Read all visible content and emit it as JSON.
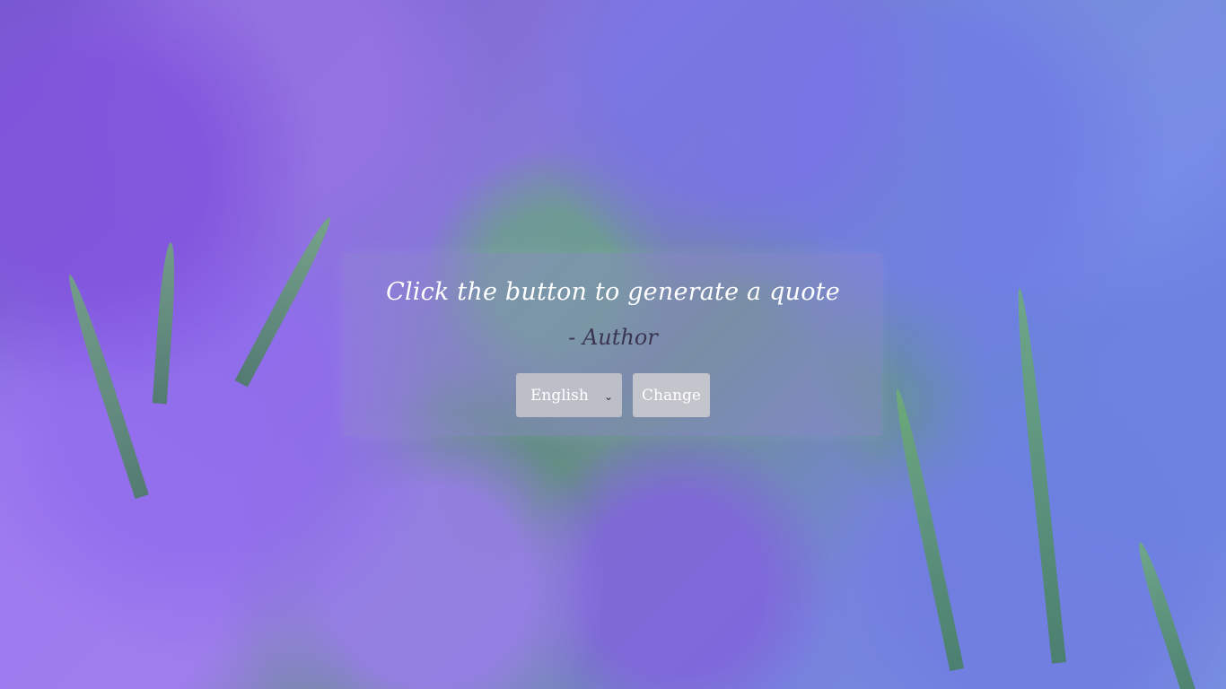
{
  "quote": {
    "text": "Click the button to generate a quote",
    "author": "- Author"
  },
  "controls": {
    "language": {
      "selected": "English",
      "icon": "chevron-down-icon"
    },
    "change_label": "Change"
  },
  "colors": {
    "quote_text": "#ffffff",
    "author_text": "#3a3550",
    "button_bg": "#c3c4cc",
    "panel_bg": "rgba(150,140,210,0.35)"
  }
}
